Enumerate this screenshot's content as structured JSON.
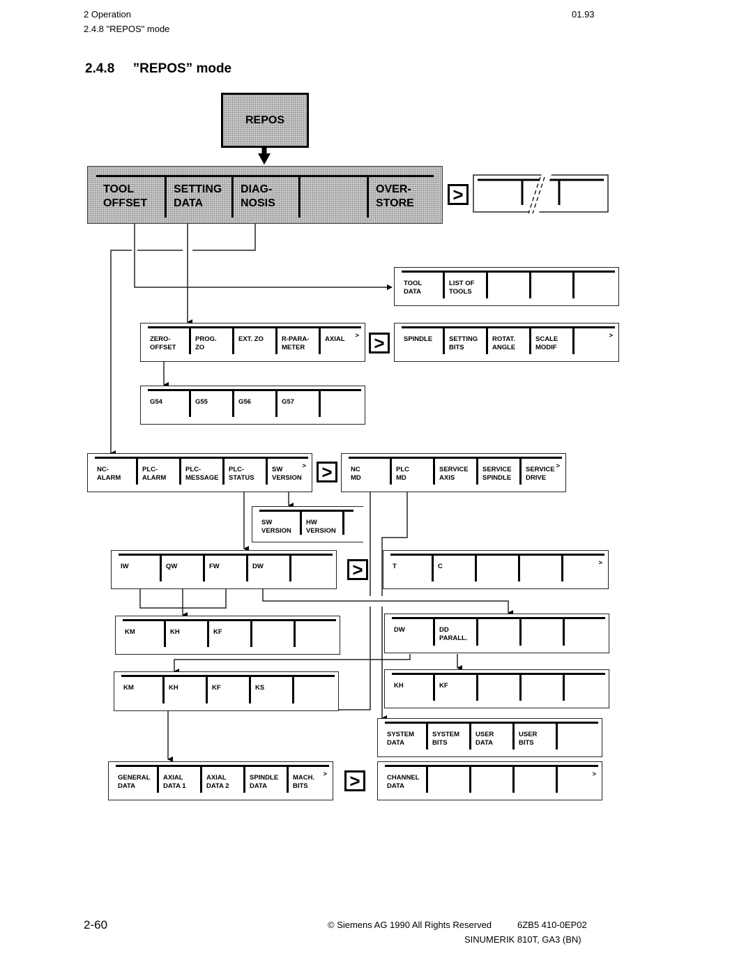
{
  "header": {
    "chapter": "2  Operation",
    "section": "2.4.8  \"REPOS\" mode",
    "date": "01.93"
  },
  "title": "2.4.8     ”REPOS” mode",
  "diagram": {
    "root": {
      "label": "REPOS"
    },
    "main_menu": {
      "keys": [
        "TOOL\nOFFSET",
        "SETTING\nDATA",
        "DIAG-\nNOSIS",
        "",
        "OVER-\nSTORE"
      ]
    },
    "next_symbol": ">",
    "menus": {
      "tool_offset": {
        "keys": [
          "TOOL\nDATA",
          "LIST OF\nTOOLS",
          "",
          "",
          ""
        ],
        "more": ""
      },
      "setting_data": {
        "keys": [
          "ZERO-\nOFFSET",
          "PROG.\nZO",
          "EXT. ZO",
          "R-PARA-\nMETER",
          "AXIAL"
        ],
        "more": ">"
      },
      "setting_data_2": {
        "keys": [
          "SPINDLE",
          "SETTING\nBITS",
          "ROTAT.\nANGLE",
          "SCALE\nMODIF",
          ""
        ],
        "more": ">"
      },
      "zero_offset": {
        "keys": [
          "G54",
          "G55",
          "G56",
          "G57",
          ""
        ],
        "more": ""
      },
      "diagnosis": {
        "keys": [
          "NC-\nALARM",
          "PLC-\nALARM",
          "PLC-\nMESSAGE",
          "PLC-\nSTATUS",
          "SW\nVERSION"
        ],
        "more": ">"
      },
      "diagnosis_2": {
        "keys": [
          "NC\nMD",
          "PLC\nMD",
          "SERVICE\nAXIS",
          "SERVICE\nSPINDLE",
          "SERVICE\nDRIVE"
        ],
        "more": ">"
      },
      "sw_version": {
        "keys": [
          "SW\nVERSION",
          "HW\nVERSION"
        ],
        "more": ""
      },
      "plc_status": {
        "keys": [
          "IW",
          "QW",
          "FW",
          "DW",
          ""
        ],
        "more": ""
      },
      "plc_status_2": {
        "keys": [
          "T",
          "C",
          "",
          "",
          ""
        ],
        "more": ">"
      },
      "iw_qw_fw": {
        "keys": [
          "KM",
          "KH",
          "KF",
          "",
          ""
        ],
        "more": ""
      },
      "dw": {
        "keys": [
          "DW",
          "DD\nPARALL.",
          "",
          "",
          ""
        ],
        "more": ""
      },
      "dd_parall": {
        "keys": [
          "KH",
          "KF",
          "",
          "",
          ""
        ],
        "more": ""
      },
      "plc_md_format": {
        "keys": [
          "KM",
          "KH",
          "KF",
          "KS",
          ""
        ],
        "more": ""
      },
      "plc_md": {
        "keys": [
          "SYSTEM\nDATA",
          "SYSTEM\nBITS",
          "USER\nDATA",
          "USER\nBITS",
          ""
        ],
        "more": ""
      },
      "nc_md": {
        "keys": [
          "GENERAL\nDATA",
          "AXIAL\nDATA 1",
          "AXIAL\nDATA 2",
          "SPINDLE\nDATA",
          "MACH.\nBITS"
        ],
        "more": ">"
      },
      "nc_md_2": {
        "keys": [
          "CHANNEL\nDATA",
          "",
          "",
          "",
          ""
        ],
        "more": ">"
      }
    }
  },
  "footer": {
    "page": "2-60",
    "copyright": "© Siemens AG 1990 All Rights Reserved",
    "order_no": "6ZB5 410-0EP02",
    "product": "SINUMERIK 810T, GA3 (BN)"
  }
}
